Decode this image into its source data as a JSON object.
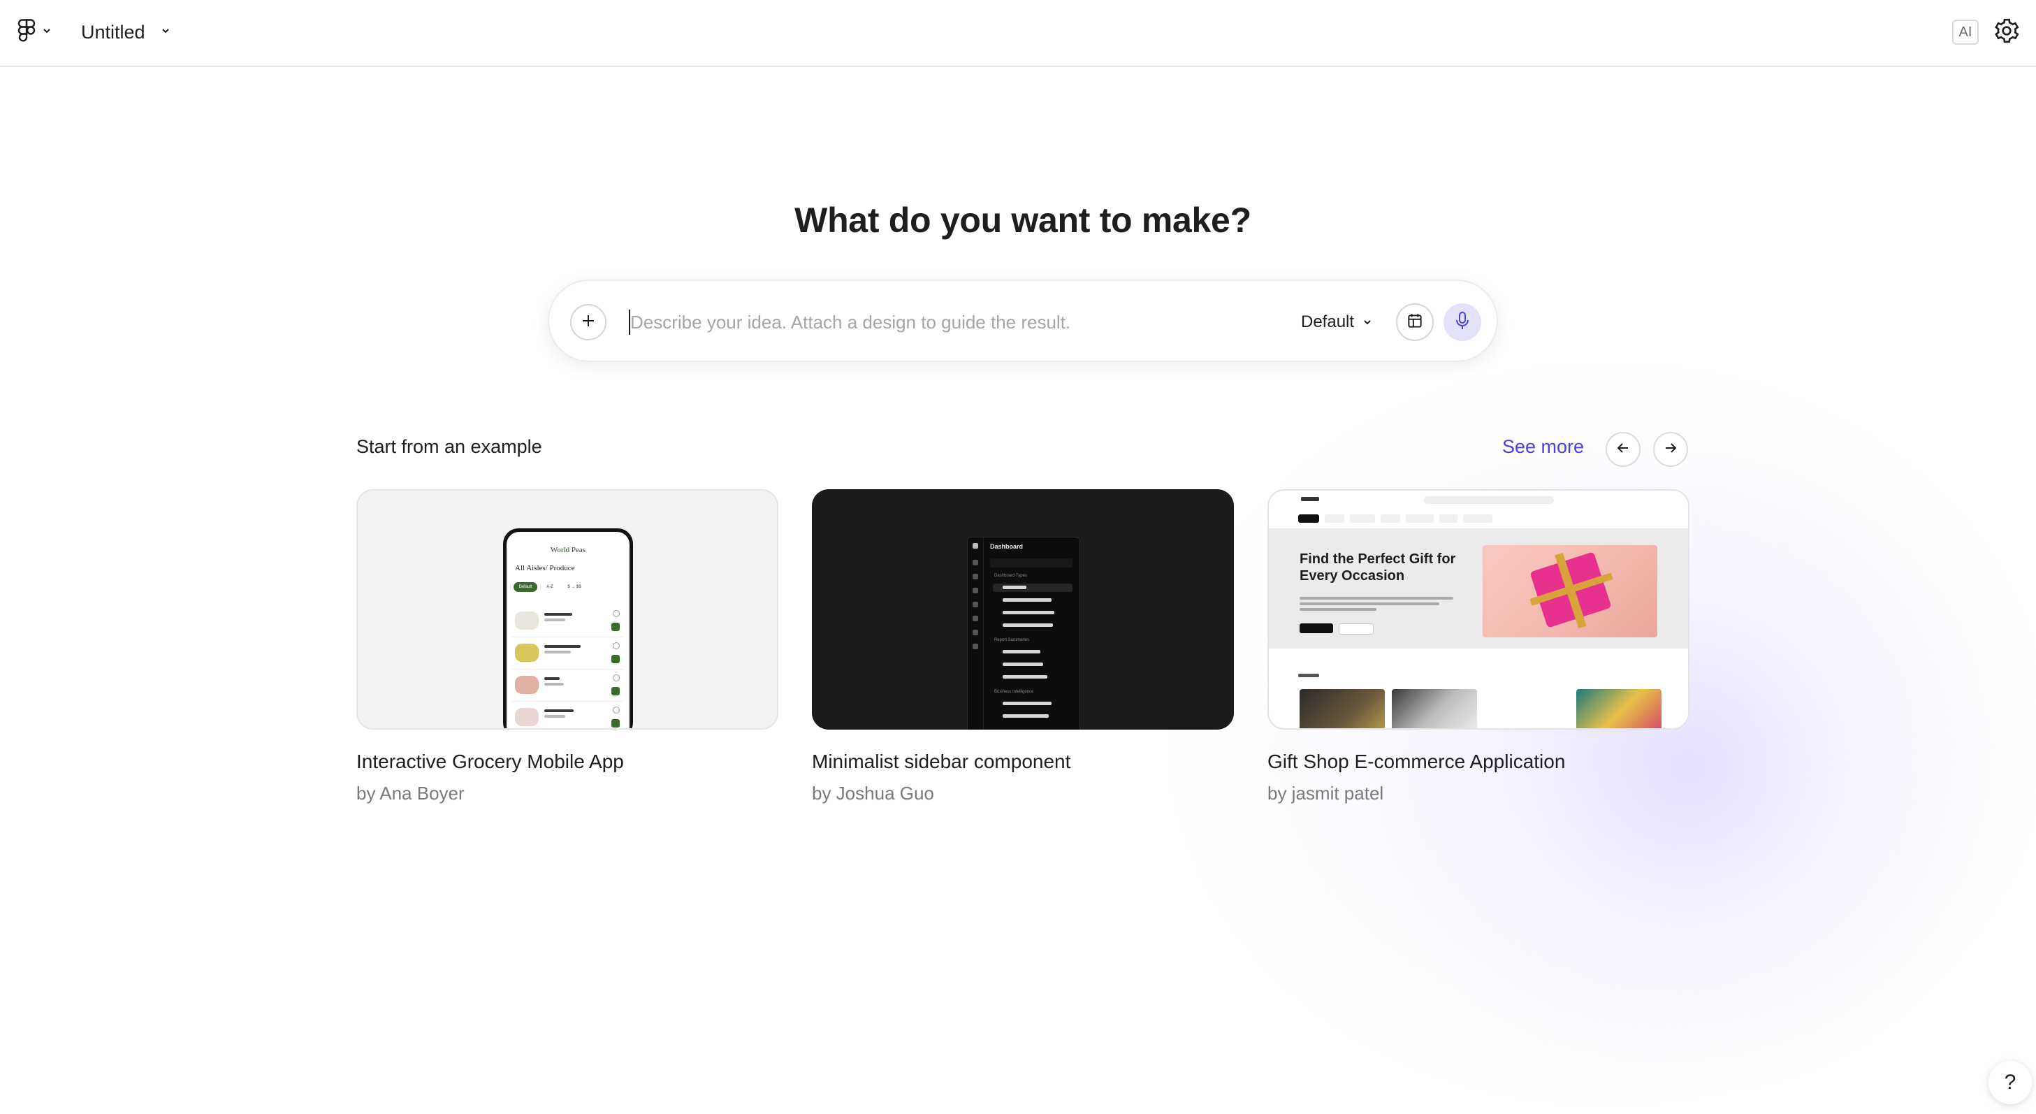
{
  "header": {
    "file_title": "Untitled",
    "ai_badge": "AI"
  },
  "hero": {
    "title": "What do you want to make?"
  },
  "prompt": {
    "placeholder": "Describe your idea. Attach a design to guide the result.",
    "model": "Default"
  },
  "examples": {
    "label": "Start from an example",
    "see_more": "See more",
    "cards": [
      {
        "title": "Interactive Grocery Mobile App",
        "author": "by Ana Boyer",
        "thumb": {
          "brand": "World Peas",
          "aisle": "All Aisles/ Produce",
          "chips": [
            "Default",
            "A-Z",
            "$ → $$"
          ]
        }
      },
      {
        "title": "Minimalist sidebar component",
        "author": "by Joshua Guo",
        "thumb": {
          "title": "Dashboard",
          "sections": [
            "Dashboard Types",
            "Report Summaries",
            "Business Intelligence"
          ]
        }
      },
      {
        "title": "Gift Shop E-commerce Application",
        "author": "by jasmit patel",
        "thumb": {
          "headline": "Find the Perfect Gift for Every Occasion"
        }
      }
    ]
  },
  "help": {
    "label": "?"
  },
  "colors": {
    "accent": "#4b40d8",
    "mic_bg": "#e4e1fb"
  }
}
